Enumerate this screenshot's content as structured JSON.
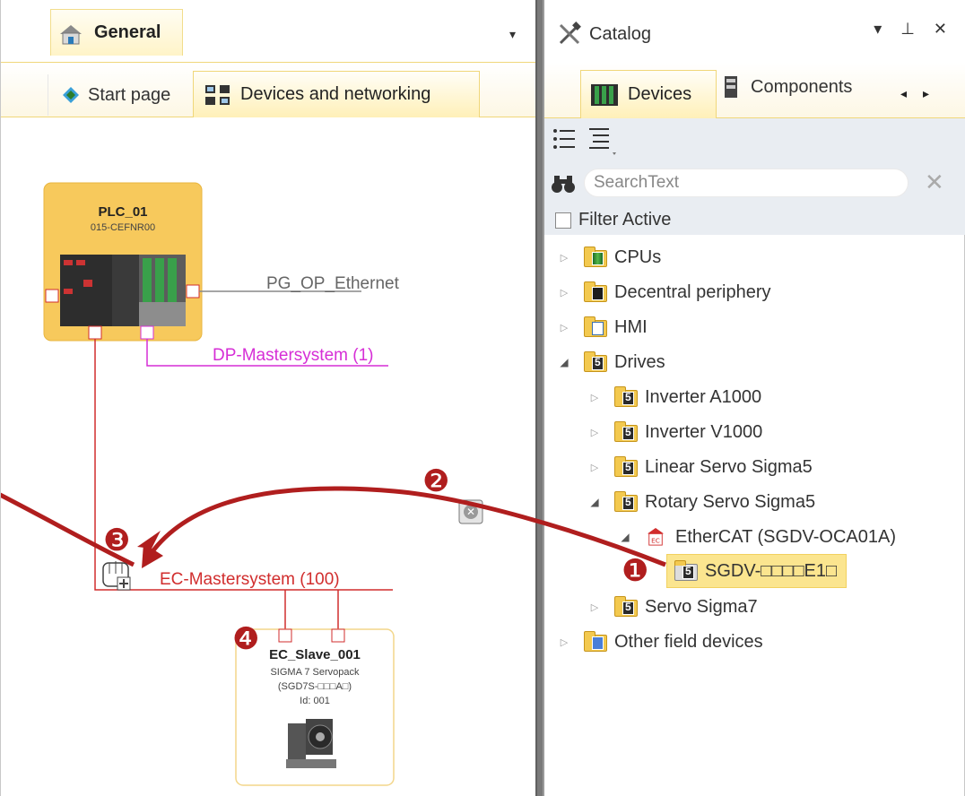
{
  "left": {
    "general_label": "General",
    "dropdown_glyph": "▾",
    "tab_start": "Start page",
    "tab_devices": "Devices and networking"
  },
  "canvas": {
    "plc": {
      "name": "PLC_01",
      "model": "015-CEFNR00"
    },
    "pg_op_ethernet": "PG_OP_Ethernet",
    "dp_master": "DP-Mastersystem (1)",
    "ec_master": "EC-Mastersystem (100)",
    "slave": {
      "name": "EC_Slave_001",
      "line1": "SIGMA 7 Servopack",
      "line2": "(SGD7S-□□□A□)",
      "line3": "Id: 001"
    },
    "markers": [
      "❶",
      "❷",
      "❸",
      "❹"
    ]
  },
  "catalog": {
    "title": "Catalog",
    "controls": "▾ ⊥ ✕",
    "tab_devices": "Devices",
    "tab_components": "Components",
    "search_placeholder": "SearchText",
    "filter_label": "Filter Active",
    "tree": [
      {
        "label": "CPUs",
        "level": 0,
        "expanded": false
      },
      {
        "label": "Decentral periphery",
        "level": 0,
        "expanded": false
      },
      {
        "label": "HMI",
        "level": 0,
        "expanded": false
      },
      {
        "label": "Drives",
        "level": 0,
        "expanded": true
      },
      {
        "label": "Inverter A1000",
        "level": 1,
        "expanded": false
      },
      {
        "label": "Inverter V1000",
        "level": 1,
        "expanded": false
      },
      {
        "label": "Linear Servo Sigma5",
        "level": 1,
        "expanded": false
      },
      {
        "label": "Rotary Servo Sigma5",
        "level": 1,
        "expanded": true
      },
      {
        "label": "EtherCAT (SGDV-OCA01A)",
        "level": 2,
        "expanded": true
      },
      {
        "label": "SGDV-□□□□E1□",
        "level": 3,
        "selected": true
      },
      {
        "label": "Servo Sigma7",
        "level": 1,
        "expanded": false
      },
      {
        "label": "Other field devices",
        "level": 0,
        "expanded": false
      }
    ]
  },
  "colors": {
    "accent_yellow": "#f7c95c",
    "connector_red": "#d12d2d",
    "dp_magenta": "#d62ed6",
    "arrow_dark_red": "#b01e1e"
  }
}
